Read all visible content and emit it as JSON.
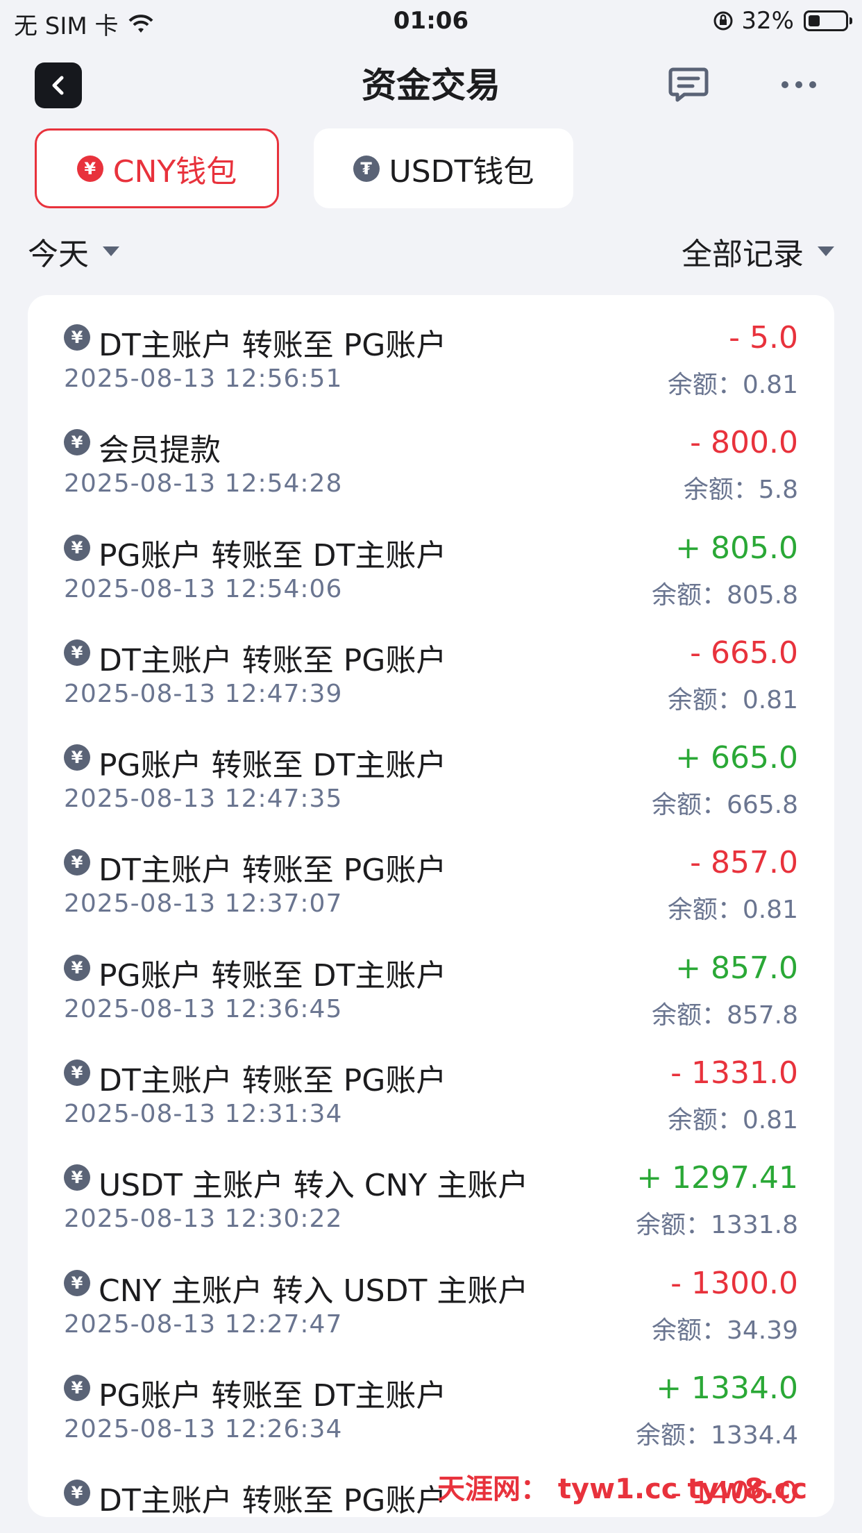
{
  "status_bar": {
    "carrier": "无 SIM 卡",
    "time": "01:06",
    "battery": "32%",
    "battery_level": 0.32
  },
  "nav": {
    "title": "资金交易"
  },
  "wallets": [
    {
      "label": "CNY钱包",
      "symbol": "¥",
      "active": true
    },
    {
      "label": "USDT钱包",
      "symbol": "₮",
      "active": false
    }
  ],
  "filters": {
    "date": "今天",
    "type": "全部记录"
  },
  "records": [
    {
      "title": "DT主账户  转账至  PG账户",
      "time": "2025-08-13 12:56:51",
      "amount": "- 5.0",
      "sign": "neg",
      "balance": "余额：0.81"
    },
    {
      "title": "会员提款",
      "time": "2025-08-13 12:54:28",
      "amount": "- 800.0",
      "sign": "neg",
      "balance": "余额：5.8"
    },
    {
      "title": "PG账户  转账至  DT主账户",
      "time": "2025-08-13 12:54:06",
      "amount": "+ 805.0",
      "sign": "pos",
      "balance": "余额：805.8"
    },
    {
      "title": "DT主账户  转账至  PG账户",
      "time": "2025-08-13 12:47:39",
      "amount": "- 665.0",
      "sign": "neg",
      "balance": "余额：0.81"
    },
    {
      "title": "PG账户  转账至  DT主账户",
      "time": "2025-08-13 12:47:35",
      "amount": "+ 665.0",
      "sign": "pos",
      "balance": "余额：665.8"
    },
    {
      "title": "DT主账户  转账至  PG账户",
      "time": "2025-08-13 12:37:07",
      "amount": "- 857.0",
      "sign": "neg",
      "balance": "余额：0.81"
    },
    {
      "title": "PG账户  转账至  DT主账户",
      "time": "2025-08-13 12:36:45",
      "amount": "+ 857.0",
      "sign": "pos",
      "balance": "余额：857.8"
    },
    {
      "title": "DT主账户  转账至  PG账户",
      "time": "2025-08-13 12:31:34",
      "amount": "- 1331.0",
      "sign": "neg",
      "balance": "余额：0.81"
    },
    {
      "title": "USDT 主账户  转入  CNY 主账户",
      "time": "2025-08-13 12:30:22",
      "amount": "+ 1297.41",
      "sign": "pos",
      "balance": "余额：1331.8"
    },
    {
      "title": "CNY 主账户  转入  USDT 主账户",
      "time": "2025-08-13 12:27:47",
      "amount": "- 1300.0",
      "sign": "neg",
      "balance": "余额：34.39"
    },
    {
      "title": "PG账户  转账至  DT主账户",
      "time": "2025-08-13 12:26:34",
      "amount": "+ 1334.0",
      "sign": "pos",
      "balance": "余额：1334.4"
    },
    {
      "title": "DT主账户  转账至  PG账户",
      "time": "",
      "amount": "- 1406.0",
      "sign": "neg",
      "balance": ""
    }
  ],
  "watermark": "天涯网： tyw1.cc  tyw8.cc",
  "colors": {
    "negative": "#e8323c",
    "positive": "#2aa836",
    "accent": "#e8323c"
  }
}
